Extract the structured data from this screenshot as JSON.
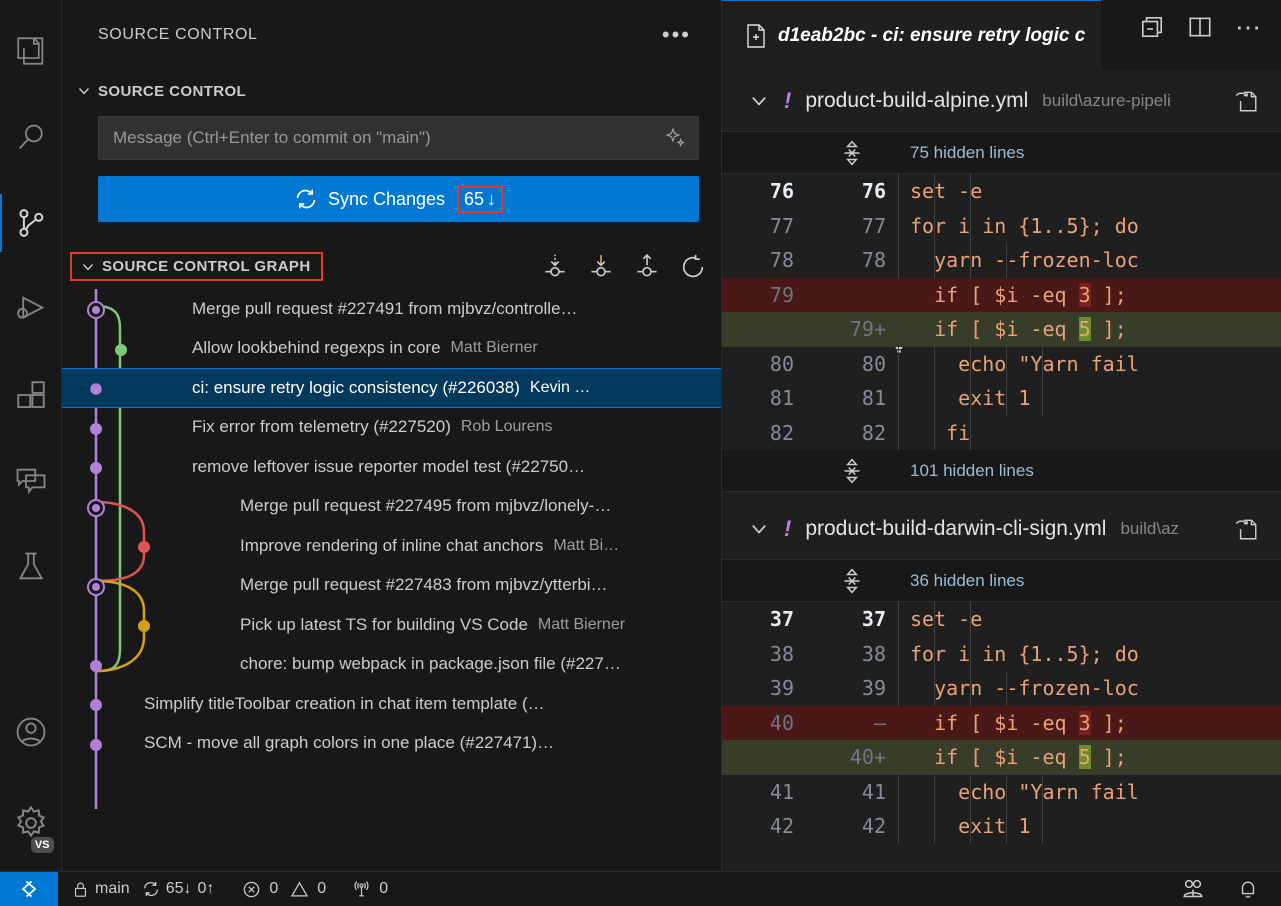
{
  "activity_bar": {
    "items": [
      {
        "name": "explorer",
        "icon": "files-icon",
        "active": false
      },
      {
        "name": "search",
        "icon": "search-icon",
        "active": false
      },
      {
        "name": "source-control",
        "icon": "source-control-icon",
        "active": true
      },
      {
        "name": "run-and-debug",
        "icon": "run-debug-icon",
        "active": false
      },
      {
        "name": "extensions",
        "icon": "extensions-icon",
        "active": false
      },
      {
        "name": "chat",
        "icon": "chat-icon",
        "active": false
      },
      {
        "name": "testing",
        "icon": "beaker-icon",
        "active": false
      }
    ],
    "bottom_items": [
      {
        "name": "accounts",
        "icon": "account-icon"
      },
      {
        "name": "settings",
        "icon": "gear-icon",
        "badge": "VS"
      }
    ]
  },
  "sidebar": {
    "title": "SOURCE CONTROL",
    "more_actions": "•••",
    "scm_section": {
      "label": "SOURCE CONTROL",
      "commit_input_placeholder": "Message (Ctrl+Enter to commit on \"main\")",
      "commit_input_value": "",
      "generate_message_icon": "sparkle-icon",
      "sync_button": {
        "label": "Sync Changes",
        "count": "65",
        "arrow": "↓",
        "icon": "sync-icon",
        "highlight_color": "#e8372c",
        "background": "#0078d4"
      }
    },
    "graph_section": {
      "label": "SOURCE CONTROL GRAPH",
      "highlight_color": "#e8372c",
      "actions": [
        {
          "name": "fetch-button",
          "icon": "fetch-icon"
        },
        {
          "name": "pull-button",
          "icon": "pull-icon"
        },
        {
          "name": "push-button",
          "icon": "push-icon"
        },
        {
          "name": "refresh-button",
          "icon": "refresh-icon"
        }
      ],
      "commits": [
        {
          "subject": "Merge pull request #227491 from mjbvz/controlle…",
          "author": "",
          "selected": false,
          "node": "merge",
          "color": "#b180d7",
          "indent": 0
        },
        {
          "subject": "Allow lookbehind regexps in core",
          "author": "Matt Bierner",
          "selected": false,
          "node": "dot",
          "color": "#7ac87a",
          "indent": 1
        },
        {
          "subject": "ci: ensure retry logic consistency (#226038)",
          "author": "Kevin …",
          "selected": true,
          "node": "dot",
          "color": "#b180d7",
          "indent": 0
        },
        {
          "subject": "Fix error from telemetry (#227520)",
          "author": "Rob Lourens",
          "selected": false,
          "node": "dot",
          "color": "#b180d7",
          "indent": 0
        },
        {
          "subject": "remove leftover issue reporter model test (#22750…",
          "author": "",
          "selected": false,
          "node": "dot",
          "color": "#b180d7",
          "indent": 0
        },
        {
          "subject": "Merge pull request #227495 from mjbvz/lonely-…",
          "author": "",
          "selected": false,
          "node": "merge",
          "color": "#b180d7",
          "indent": 2
        },
        {
          "subject": "Improve rendering of inline chat anchors",
          "author": "Matt Bi…",
          "selected": false,
          "node": "dot",
          "color": "#e05252",
          "indent": 2
        },
        {
          "subject": "Merge pull request #227483 from mjbvz/ytterbi…",
          "author": "",
          "selected": false,
          "node": "merge",
          "color": "#b180d7",
          "indent": 2
        },
        {
          "subject": "Pick up latest TS for building VS Code",
          "author": "Matt Bierner",
          "selected": false,
          "node": "dot",
          "color": "#d4a017",
          "indent": 2
        },
        {
          "subject": "chore: bump webpack in package.json file (#227…",
          "author": "",
          "selected": false,
          "node": "dot",
          "color": "#b180d7",
          "indent": 2
        },
        {
          "subject": "Simplify titleToolbar creation in chat item template (…",
          "author": "",
          "selected": false,
          "node": "dot",
          "color": "#b180d7",
          "indent": 0
        },
        {
          "subject": "SCM - move all graph colors in one place (#227471)…",
          "author": "",
          "selected": false,
          "node": "dot",
          "color": "#b180d7",
          "indent": 0
        }
      ]
    }
  },
  "editor": {
    "tab": {
      "icon": "diff-file-icon",
      "label": "d1eab2bc - ci: ensure retry logic c",
      "active": true
    },
    "actions": [
      {
        "name": "unmaximize-panel-button",
        "icon": "restore-panel-icon"
      },
      {
        "name": "split-editor-button",
        "icon": "split-editor-icon"
      },
      {
        "name": "more-actions-button",
        "icon": "ellipsis-icon"
      }
    ],
    "files": [
      {
        "name": "product-build-alpine.yml",
        "path": "build\\azure-pipeli",
        "status_marker": "!",
        "status_color": "#bf7fe8",
        "collapse_icon": "chevron-down-icon",
        "goto_icon": "go-to-file-icon",
        "hidden_before": "75 hidden lines",
        "hidden_after": "101 hidden lines",
        "lines": [
          {
            "old": "76",
            "new": "76",
            "text": "set -e",
            "type": "ctx",
            "first": true,
            "indent": 1
          },
          {
            "old": "77",
            "new": "77",
            "text": "for i in {1..5}; do",
            "type": "ctx",
            "indent": 1
          },
          {
            "old": "78",
            "new": "78",
            "text": "  yarn --frozen-loc",
            "type": "ctx",
            "indent": 2
          },
          {
            "old": "79",
            "new": "",
            "text": "  if [ $i -eq 3 ];",
            "type": "del",
            "token": "3",
            "indent": 2,
            "lightbulb": true
          },
          {
            "old": "",
            "new": "79+",
            "text": "  if [ $i -eq 5 ];",
            "type": "ins",
            "token": "5",
            "indent": 2
          },
          {
            "old": "80",
            "new": "80",
            "text": "    echo \"Yarn fail",
            "type": "ctx",
            "indent": 3
          },
          {
            "old": "81",
            "new": "81",
            "text": "    exit 1",
            "type": "ctx",
            "indent": 3
          },
          {
            "old": "82",
            "new": "82",
            "text": "   fi",
            "type": "ctx",
            "indent": 2
          }
        ]
      },
      {
        "name": "product-build-darwin-cli-sign.yml",
        "path": "build\\az",
        "status_marker": "!",
        "status_color": "#bf7fe8",
        "collapse_icon": "chevron-down-icon",
        "goto_icon": "go-to-file-icon",
        "hidden_before": "36 hidden lines",
        "hidden_after": "",
        "lines": [
          {
            "old": "37",
            "new": "37",
            "text": "set -e",
            "type": "ctx",
            "first": true,
            "indent": 1
          },
          {
            "old": "38",
            "new": "38",
            "text": "for i in {1..5}; do",
            "type": "ctx",
            "indent": 1
          },
          {
            "old": "39",
            "new": "39",
            "text": "  yarn --frozen-loc",
            "type": "ctx",
            "indent": 2
          },
          {
            "old": "40",
            "new": "—",
            "text": "  if [ $i -eq 3 ];",
            "type": "del",
            "token": "3",
            "indent": 2
          },
          {
            "old": "",
            "new": "40+",
            "text": "  if [ $i -eq 5 ];",
            "type": "ins",
            "token": "5",
            "indent": 2
          },
          {
            "old": "41",
            "new": "41",
            "text": "    echo \"Yarn fail",
            "type": "ctx",
            "indent": 3
          },
          {
            "old": "42",
            "new": "42",
            "text": "    exit 1",
            "type": "ctx",
            "indent": 3
          }
        ]
      }
    ]
  },
  "status_bar": {
    "remote_icon": "remote-window-icon",
    "branch": {
      "icon": "lock-icon",
      "label": "main"
    },
    "sync": {
      "icon": "sync-icon",
      "incoming": "65↓",
      "outgoing": "0↑"
    },
    "problems": {
      "errors_icon": "error-icon",
      "errors": "0",
      "warnings_icon": "warning-icon",
      "warnings": "0"
    },
    "ports": {
      "icon": "radio-tower-icon",
      "count": "0"
    },
    "right_items": [
      {
        "name": "live-share-button",
        "icon": "live-share-icon"
      },
      {
        "name": "notifications-button",
        "icon": "bell-icon"
      }
    ]
  }
}
